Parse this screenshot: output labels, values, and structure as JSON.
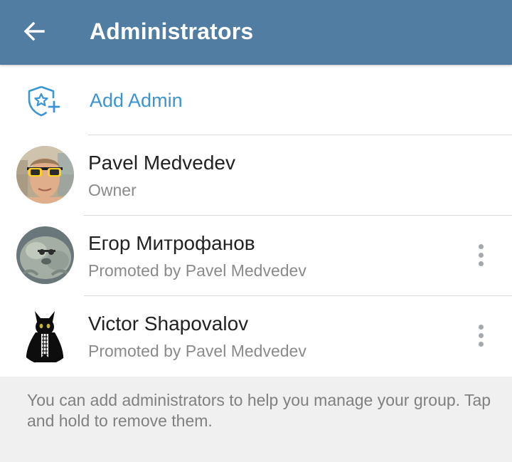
{
  "header": {
    "title": "Administrators",
    "back_icon": "arrow-left-icon",
    "background_color": "#527da3"
  },
  "add_admin": {
    "label": "Add Admin",
    "icon": "shield-star-plus-icon",
    "accent_color": "#3a95d5"
  },
  "admins": [
    {
      "name": "Pavel Medvedev",
      "role": "Owner",
      "avatar": "avatar-man-sunglasses",
      "has_menu": false
    },
    {
      "name": "Егор Митрофанов",
      "role": "Promoted by Pavel Medvedev",
      "avatar": "avatar-tardigrade",
      "has_menu": true
    },
    {
      "name": "Victor Shapovalov",
      "role": "Promoted by Pavel Medvedev",
      "avatar": "avatar-black-cat",
      "has_menu": true
    }
  ],
  "info": {
    "text": "You can add administrators to help you manage your group. Tap and hold to remove them."
  }
}
